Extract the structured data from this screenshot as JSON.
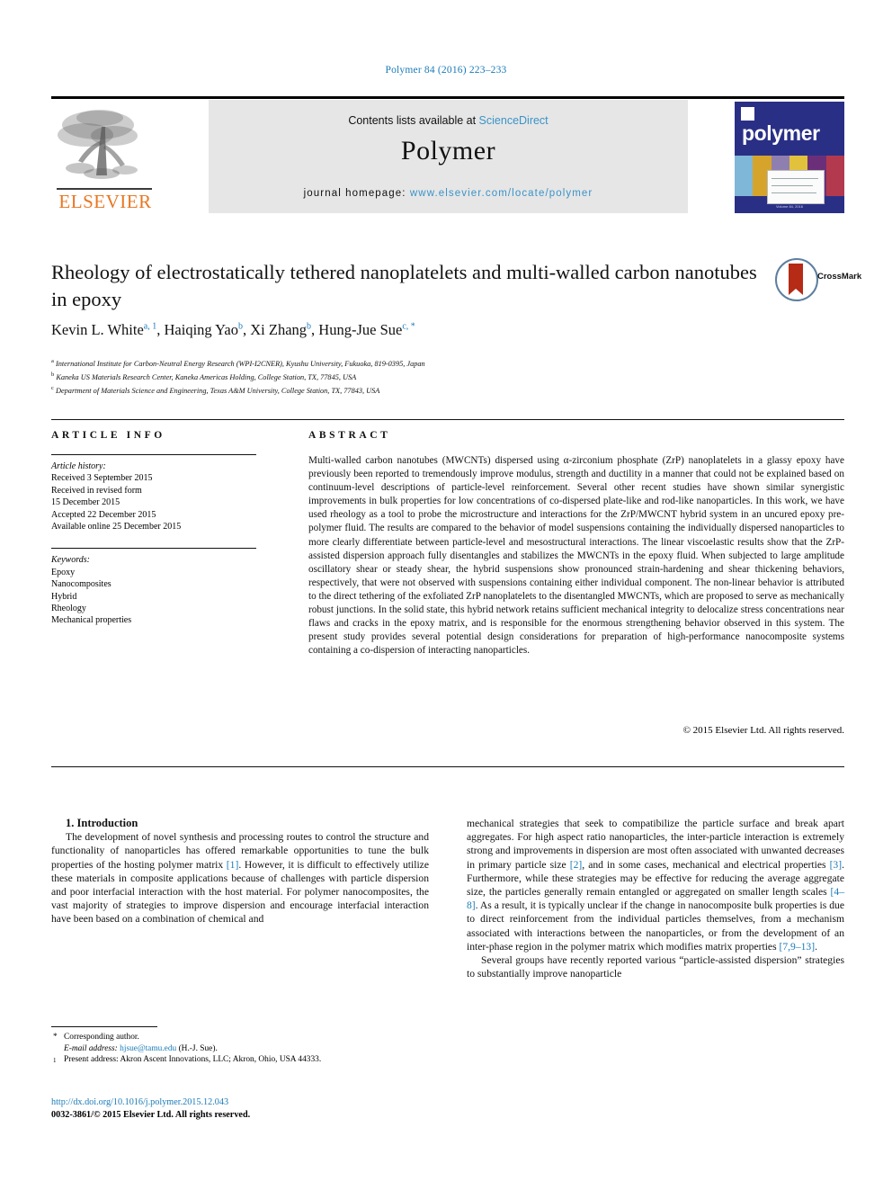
{
  "running_head": "Polymer 84 (2016) 223–233",
  "masthead": {
    "contents_prefix": "Contents lists available at ",
    "sciencedirect": "ScienceDirect",
    "journal_name": "Polymer",
    "homepage_prefix": "journal homepage: ",
    "homepage_url": "www.elsevier.com/locate/polymer",
    "publisher_logo_text": "ELSEVIER",
    "cover_title": "polymer",
    "cover_footer": "Volume 84, 2016"
  },
  "article": {
    "title": "Rheology of electrostatically tethered nanoplatelets and multi-walled carbon nanotubes in epoxy",
    "authors": [
      {
        "name": "Kevin L. White",
        "marks": "a, 1"
      },
      {
        "name": "Haiqing Yao",
        "marks": "b"
      },
      {
        "name": "Xi Zhang",
        "marks": "b"
      },
      {
        "name": "Hung-Jue Sue",
        "marks": "c, *"
      }
    ],
    "affiliations": [
      {
        "mark": "a",
        "text": "International Institute for Carbon-Neutral Energy Research (WPI-I2CNER), Kyushu University, Fukuoka, 819-0395, Japan"
      },
      {
        "mark": "b",
        "text": "Kaneka US Materials Research Center, Kaneka Americas Holding, College Station, TX, 77845, USA"
      },
      {
        "mark": "c",
        "text": "Department of Materials Science and Engineering, Texas A&M University, College Station, TX, 77843, USA"
      }
    ],
    "crossmark_label": "CrossMark"
  },
  "article_info": {
    "heading": "ARTICLE INFO",
    "history_label": "Article history:",
    "history": [
      "Received 3 September 2015",
      "Received in revised form",
      "15 December 2015",
      "Accepted 22 December 2015",
      "Available online 25 December 2015"
    ],
    "keywords_label": "Keywords:",
    "keywords": [
      "Epoxy",
      "Nanocomposites",
      "Hybrid",
      "Rheology",
      "Mechanical properties"
    ]
  },
  "abstract": {
    "heading": "ABSTRACT",
    "text": "Multi-walled carbon nanotubes (MWCNTs) dispersed using α-zirconium phosphate (ZrP) nanoplatelets in a glassy epoxy have previously been reported to tremendously improve modulus, strength and ductility in a manner that could not be explained based on continuum-level descriptions of particle-level reinforcement. Several other recent studies have shown similar synergistic improvements in bulk properties for low concentrations of co-dispersed plate-like and rod-like nanoparticles. In this work, we have used rheology as a tool to probe the microstructure and interactions for the ZrP/MWCNT hybrid system in an uncured epoxy pre-polymer fluid. The results are compared to the behavior of model suspensions containing the individually dispersed nanoparticles to more clearly differentiate between particle-level and mesostructural interactions. The linear viscoelastic results show that the ZrP-assisted dispersion approach fully disentangles and stabilizes the MWCNTs in the epoxy fluid. When subjected to large amplitude oscillatory shear or steady shear, the hybrid suspensions show pronounced strain-hardening and shear thickening behaviors, respectively, that were not observed with suspensions containing either individual component. The non-linear behavior is attributed to the direct tethering of the exfoliated ZrP nanoplatelets to the disentangled MWCNTs, which are proposed to serve as mechanically robust junctions. In the solid state, this hybrid network retains sufficient mechanical integrity to delocalize stress concentrations near flaws and cracks in the epoxy matrix, and is responsible for the enormous strengthening behavior observed in this system. The present study provides several potential design considerations for preparation of high-performance nanocomposite systems containing a co-dispersion of interacting nanoparticles.",
    "copyright": "© 2015 Elsevier Ltd. All rights reserved."
  },
  "introduction": {
    "heading": "1. Introduction",
    "left_paragraph_1a": "The development of novel synthesis and processing routes to control the structure and functionality of nanoparticles has offered remarkable opportunities to tune the bulk properties of the hosting polymer matrix ",
    "cite_1": "[1]",
    "left_paragraph_1b": ". However, it is difficult to effectively utilize these materials in composite applications because of challenges with particle dispersion and poor interfacial interaction with the host material. For polymer nanocomposites, the vast majority of strategies to improve dispersion and encourage interfacial interaction have been based on a combination of chemical and",
    "right_paragraph_1a": "mechanical strategies that seek to compatibilize the particle surface and break apart aggregates. For high aspect ratio nanoparticles, the inter-particle interaction is extremely strong and improvements in dispersion are most often associated with unwanted decreases in primary particle size ",
    "cite_2": "[2]",
    "right_paragraph_1b": ", and in some cases, mechanical and electrical properties ",
    "cite_3": "[3]",
    "right_paragraph_1c": ". Furthermore, while these strategies may be effective for reducing the average aggregate size, the particles generally remain entangled or aggregated on smaller length scales ",
    "cite_4": "[4–8]",
    "right_paragraph_1d": ". As a result, it is typically unclear if the change in nanocomposite bulk properties is due to direct reinforcement from the individual particles themselves, from a mechanism associated with interactions between the nanoparticles, or from the development of an inter-phase region in the polymer matrix which modifies matrix properties ",
    "cite_5": "[7,9–13]",
    "right_paragraph_1e": ".",
    "right_paragraph_2": "Several groups have recently reported various “particle-assisted dispersion” strategies to substantially improve nanoparticle"
  },
  "footnotes": {
    "corresponding_marker": "*",
    "corresponding_text": "Corresponding author.",
    "email_label": "E-mail address:",
    "email": "hjsue@tamu.edu",
    "email_owner": "(H.-J. Sue).",
    "present_marker": "1",
    "present_text": "Present address: Akron Ascent Innovations, LLC; Akron, Ohio, USA 44333."
  },
  "footer": {
    "doi": "http://dx.doi.org/10.1016/j.polymer.2015.12.043",
    "issn_line": "0032-3861/© 2015 Elsevier Ltd. All rights reserved."
  },
  "colors": {
    "link_blue": "#1a7bb9",
    "elsevier_orange": "#e87722",
    "cover_blue": "#2a2f86"
  }
}
